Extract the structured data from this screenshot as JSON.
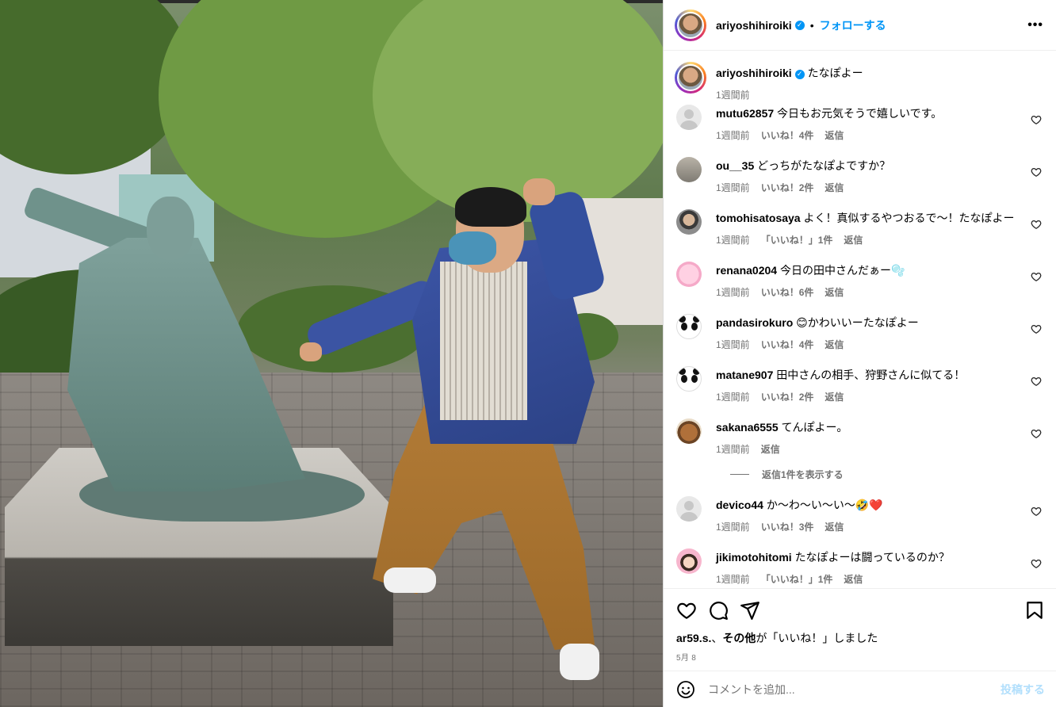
{
  "post": {
    "username": "ariyoshihiroiki",
    "verified_mark": "✓",
    "separator": "•",
    "follow_label": "フォローする",
    "more_label": "•••",
    "caption_text": "たなぽよー",
    "caption_time": "1週間前",
    "image_subject": "man in blue jacket posing beside bronze statue"
  },
  "comments": [
    {
      "user": "mutu62857",
      "text": "今日もお元気そうで嬉しいです。",
      "time": "1週間前",
      "likes": "いいね！4件",
      "reply": "返信",
      "avatar": "default"
    },
    {
      "user": "ou__35",
      "text": "どっちがたなぽよですか？",
      "time": "1週間前",
      "likes": "いいね！2件",
      "reply": "返信",
      "avatar": "photo"
    },
    {
      "user": "tomohisatosaya",
      "text": "よく！真似するやつおるで〜！たなぽよー",
      "time": "1週間前",
      "likes": "「いいね！」1件",
      "reply": "返信",
      "avatar": "man"
    },
    {
      "user": "renana0204",
      "text": "今日の田中さんだぁー🫧",
      "time": "1週間前",
      "likes": "いいね！6件",
      "reply": "返信",
      "avatar": "pink"
    },
    {
      "user": "pandasirokuro",
      "text": "😊かわいいーたなぽよー",
      "time": "1週間前",
      "likes": "いいね！4件",
      "reply": "返信",
      "avatar": "panda"
    },
    {
      "user": "matane907",
      "text": "田中さんの相手、狩野さんに似てる！",
      "time": "1週間前",
      "likes": "いいね！2件",
      "reply": "返信",
      "avatar": "panda"
    },
    {
      "user": "sakana6555",
      "text": "てんぽよー。",
      "time": "1週間前",
      "likes": "",
      "reply": "返信",
      "avatar": "food"
    },
    {
      "user": "devico44",
      "text": "か〜わ〜い〜い〜🤣❤️",
      "time": "1週間前",
      "likes": "いいね！3件",
      "reply": "返信",
      "avatar": "default"
    },
    {
      "user": "jikimotohitomi",
      "text": "たなぽよーは闘っているのか？",
      "time": "1週間前",
      "likes": "「いいね！」1件",
      "reply": "返信",
      "avatar": "girl"
    }
  ],
  "more_replies_label": "返信1件を表示する",
  "footer": {
    "liked_by_user": "ar59.s.",
    "liked_by_other": "その他",
    "liked_by_suffix": "が「いいね！」しました",
    "date": "5月 8",
    "comment_placeholder": "コメントを追加...",
    "post_label": "投稿する"
  },
  "colors": {
    "accent": "#0095f6",
    "post_disabled": "#b2dffc",
    "muted_text": "#737373"
  },
  "icons": [
    "heart-icon",
    "comment-icon",
    "share-icon",
    "bookmark-icon",
    "emoji-icon",
    "more-icon",
    "verified-icon"
  ]
}
